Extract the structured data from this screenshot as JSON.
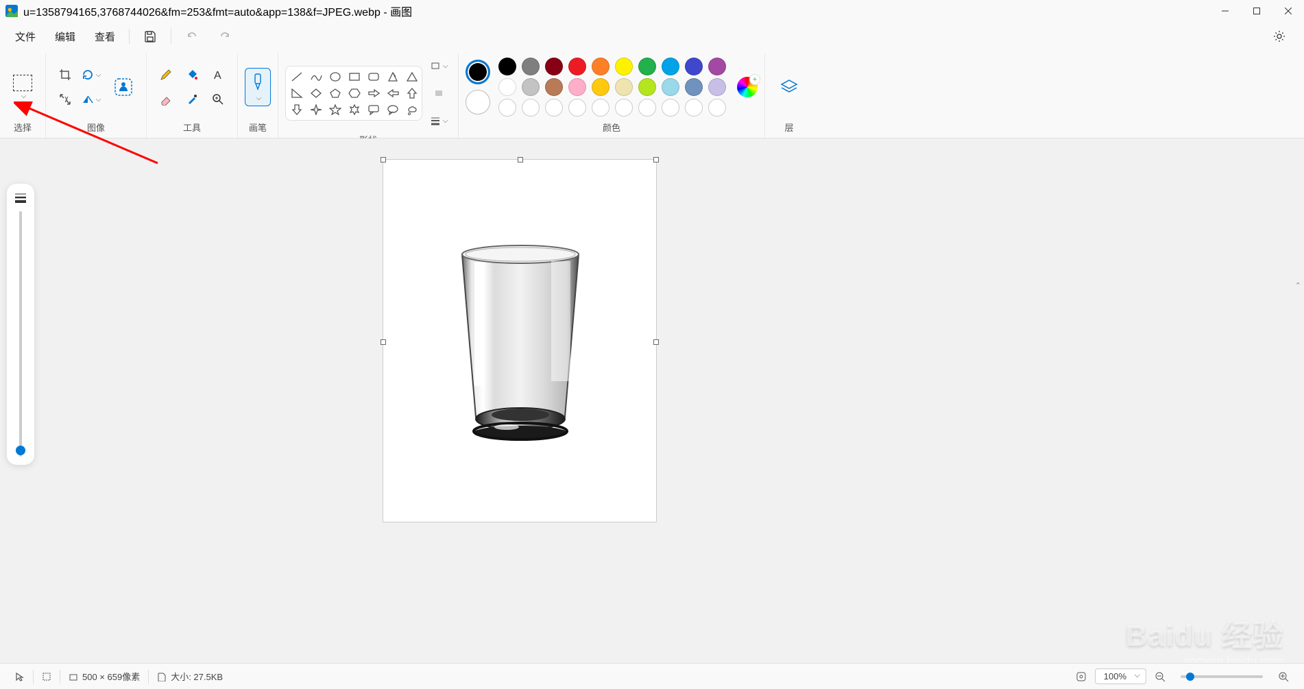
{
  "titlebar": {
    "title": "u=1358794165,3768744026&fm=253&fmt=auto&app=138&f=JPEG.webp - 画图"
  },
  "menu": {
    "file": "文件",
    "edit": "编辑",
    "view": "查看"
  },
  "ribbon": {
    "select_label": "选择",
    "image_label": "图像",
    "tools_label": "工具",
    "brush_label": "画笔",
    "shapes_label": "形状",
    "colors_label": "颜色",
    "layers_label": "层"
  },
  "palette_row1": [
    "#000000",
    "#7f7f7f",
    "#880015",
    "#ed1c24",
    "#ff7f27",
    "#fff200",
    "#22b14c",
    "#00a2e8",
    "#3f48cc",
    "#a349a4"
  ],
  "palette_row2": [
    "#ffffff",
    "#c3c3c3",
    "#b97a57",
    "#ffaec9",
    "#ffc90e",
    "#efe4b0",
    "#b5e61d",
    "#99d9ea",
    "#7092be",
    "#c8bfe7"
  ],
  "status": {
    "dimensions": "500 × 659像素",
    "size_label": "大小: 27.5KB",
    "zoom": "100%"
  },
  "watermark": {
    "main": "Baidu 经验",
    "sub": "jingyan.baidu.com"
  }
}
